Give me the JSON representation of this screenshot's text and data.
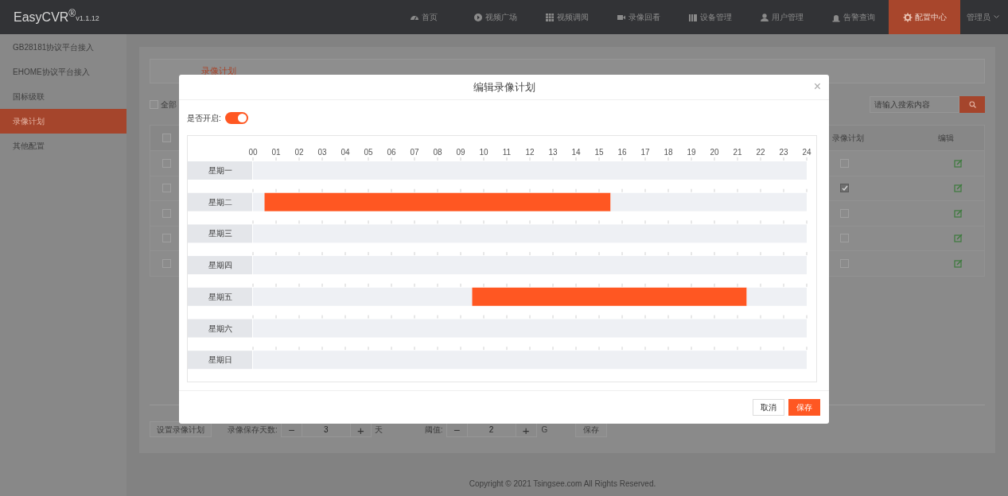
{
  "header": {
    "logo": "EasyCVR$^{®}$",
    "version": "v1.1.12",
    "nav": [
      {
        "label": "首页",
        "selected": false
      },
      {
        "label": "视频广场",
        "selected": false
      },
      {
        "label": "视频调阅",
        "selected": false
      },
      {
        "label": "录像回看",
        "selected": false
      },
      {
        "label": "设备管理",
        "selected": false
      },
      {
        "label": "用户管理",
        "selected": false
      },
      {
        "label": "告警查询",
        "selected": false
      },
      {
        "label": "配置中心",
        "selected": true
      }
    ],
    "user_menu": "管理员"
  },
  "sidebar": {
    "items": [
      {
        "label": "GB28181协议平台接入",
        "selected": false
      },
      {
        "label": "EHOME协议平台接入",
        "selected": false
      },
      {
        "label": "国标级联",
        "selected": false
      },
      {
        "label": "录像计划",
        "selected": true
      },
      {
        "label": "其他配置",
        "selected": false
      }
    ]
  },
  "content": {
    "tabs": [
      {
        "label": "录像计划",
        "selected": true
      }
    ],
    "select_all": {
      "label": "全部",
      "checked": false
    },
    "search": {
      "placeholder": "请输入搜索内容"
    },
    "table": {
      "header_checkbox": {
        "checked": false
      },
      "columns": [
        "录像计划",
        "编辑"
      ],
      "rows": [
        {
          "checked": false,
          "record_plan": false
        },
        {
          "checked": false,
          "record_plan": true
        },
        {
          "checked": false,
          "record_plan": false
        },
        {
          "checked": false,
          "record_plan": false
        },
        {
          "checked": false,
          "record_plan": false
        }
      ]
    },
    "controls": {
      "set_plan_button": "设置录像计划",
      "days_label": "录像保存天数:",
      "days_stepper": {
        "minus": "−",
        "value": "3",
        "plus": "+"
      },
      "days_unit": "天",
      "threshold_label": "阈值:",
      "threshold_stepper": {
        "minus": "−",
        "value": "2",
        "plus": "+"
      },
      "threshold_unit": "G",
      "save_button": "保存"
    }
  },
  "footer": "Copyright © 2021 Tsingsee.com All Rights Reserved.",
  "dialog": {
    "title": "编辑录像计划",
    "close": "×",
    "enable": {
      "label": "是否开启:",
      "on": true
    },
    "schedule": {
      "chart_data": {
        "type": "bar",
        "orientation": "horizontal",
        "stacked": true,
        "categories": [
          "星期一",
          "星期二",
          "星期三",
          "星期四",
          "星期五",
          "星期六",
          "星期日"
        ],
        "xlim": [
          0,
          24
        ],
        "xticks": [
          {
            "value": 0,
            "label": "00"
          },
          {
            "value": 1,
            "label": "01"
          },
          {
            "value": 2,
            "label": "02"
          },
          {
            "value": 3,
            "label": "03"
          },
          {
            "value": 4,
            "label": "04"
          },
          {
            "value": 5,
            "label": "05"
          },
          {
            "value": 6,
            "label": "06"
          },
          {
            "value": 7,
            "label": "07"
          },
          {
            "value": 8,
            "label": "08"
          },
          {
            "value": 9,
            "label": "09"
          },
          {
            "value": 10,
            "label": "10"
          },
          {
            "value": 11,
            "label": "11"
          },
          {
            "value": 12,
            "label": "12"
          },
          {
            "value": 13,
            "label": "13"
          },
          {
            "value": 14,
            "label": "14"
          },
          {
            "value": 15,
            "label": "15"
          },
          {
            "value": 16,
            "label": "16"
          },
          {
            "value": 17,
            "label": "17"
          },
          {
            "value": 18,
            "label": "18"
          },
          {
            "value": 19,
            "label": "19"
          },
          {
            "value": 20,
            "label": "20"
          },
          {
            "value": 21,
            "label": "21"
          },
          {
            "value": 22,
            "label": "22"
          },
          {
            "value": 23,
            "label": "23"
          },
          {
            "value": 24,
            "label": "24"
          }
        ],
        "series": [
          {
            "color": "#eef0f4",
            "values": [
              24,
              0.5,
              24,
              24,
              9.5,
              24,
              24
            ]
          },
          {
            "color": "#ff5722",
            "values": [
              null,
              15,
              null,
              null,
              11.9,
              null,
              null
            ]
          },
          {
            "color": "#eef0f4",
            "values": [
              null,
              8.5,
              null,
              null,
              2.6,
              null,
              null
            ]
          }
        ]
      }
    },
    "buttons": [
      {
        "label": "取消",
        "kind": "secondary"
      },
      {
        "label": "保存",
        "kind": "primary"
      }
    ]
  }
}
